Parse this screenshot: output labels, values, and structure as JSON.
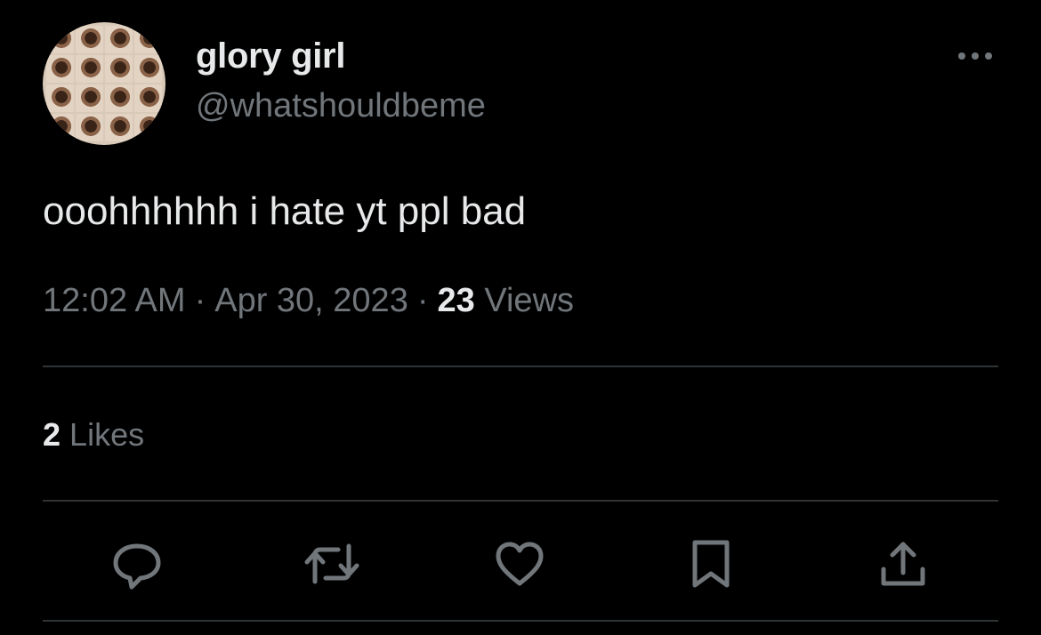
{
  "author": {
    "display_name": "glory girl",
    "handle": "@whatshouldbeme"
  },
  "tweet": {
    "text": "ooohhhhhh i hate yt ppl bad",
    "time": "12:02 AM",
    "separator": "·",
    "date": "Apr 30, 2023",
    "views_count": "23",
    "views_label": "Views"
  },
  "stats": {
    "likes_count": "2",
    "likes_label": "Likes"
  },
  "actions": [
    {
      "name": "reply",
      "icon": "speech-bubble-icon"
    },
    {
      "name": "retweet",
      "icon": "retweet-arrows-icon"
    },
    {
      "name": "like",
      "icon": "heart-icon"
    },
    {
      "name": "bookmark",
      "icon": "bookmark-icon"
    },
    {
      "name": "share",
      "icon": "share-upload-icon"
    }
  ],
  "colors": {
    "background": "#000000",
    "primary_text": "#e7e9ea",
    "secondary_text": "#71767b",
    "divider": "#2f3336"
  }
}
